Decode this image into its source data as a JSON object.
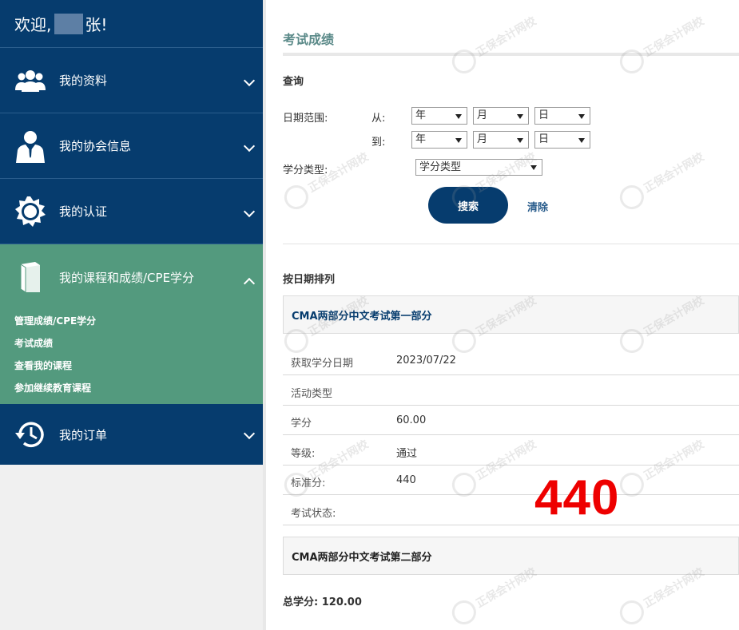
{
  "sidebar": {
    "welcome_prefix": "欢迎,",
    "welcome_suffix": "张!",
    "items": [
      {
        "label": "我的资料",
        "icon": "users-icon"
      },
      {
        "label": "我的协会信息",
        "icon": "person-icon"
      },
      {
        "label": "我的认证",
        "icon": "badge-icon"
      },
      {
        "label": "我的课程和成绩/CPE学分",
        "icon": "book-icon"
      },
      {
        "label": "我的订单",
        "icon": "history-icon"
      }
    ],
    "submenu": [
      "管理成绩/CPE学分",
      "考试成绩",
      "查看我的课程",
      "参加继续教育课程"
    ]
  },
  "main": {
    "title": "考试成绩",
    "query_title": "查询",
    "date_range_label": "日期范围:",
    "from_label": "从:",
    "to_label": "到:",
    "year_placeholder": "年",
    "month_placeholder": "月",
    "day_placeholder": "日",
    "credit_type_label": "学分类型:",
    "credit_type_value": "学分类型",
    "search_button": "搜索",
    "clear_link": "清除",
    "sort_title": "按日期排列",
    "exams": [
      {
        "name": "CMA两部分中文考试第一部分",
        "fields": [
          {
            "key": "获取学分日期",
            "value": "2023/07/22"
          },
          {
            "key": "活动类型",
            "value": ""
          },
          {
            "key": "学分",
            "value": "60.00"
          },
          {
            "key": "等级:",
            "value": "通过"
          },
          {
            "key": "标准分:",
            "value": "440"
          },
          {
            "key": "考试状态:",
            "value": ""
          }
        ]
      },
      {
        "name": "CMA两部分中文考试第二部分"
      }
    ],
    "score_highlight": "440",
    "total_label": "总学分: 120.00"
  },
  "watermark": {
    "text": "正保会计网校",
    "sub": "www.chinaacc.com"
  },
  "colors": {
    "navy": "#063c6e",
    "green": "#539a7e",
    "red": "#ee0000"
  }
}
